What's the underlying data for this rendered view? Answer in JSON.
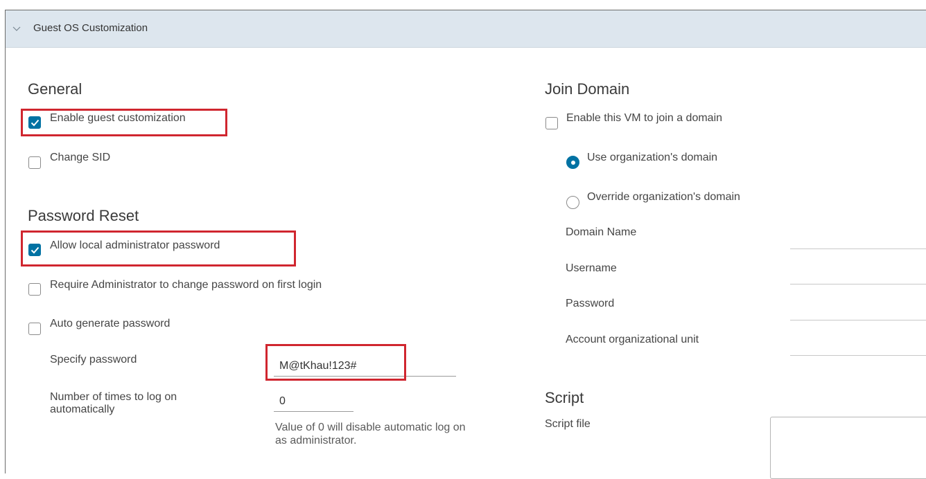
{
  "section": {
    "title": "Guest OS Customization",
    "icon": "chevron-down-icon"
  },
  "general": {
    "heading": "General",
    "enable_guest_customization": {
      "label": "Enable guest customization",
      "checked": true
    },
    "change_sid": {
      "label": "Change SID",
      "checked": false
    }
  },
  "password_reset": {
    "heading": "Password Reset",
    "allow_local_admin_password": {
      "label": "Allow local administrator password",
      "checked": true
    },
    "require_admin_change": {
      "label": "Require Administrator to change password on first login",
      "checked": false
    },
    "auto_generate": {
      "label": "Auto generate password",
      "checked": false
    },
    "specify_password": {
      "label": "Specify password",
      "value": "M@tKhau!123#"
    },
    "auto_logon": {
      "label_line1": "Number of times to log on",
      "label_line2": "automatically",
      "value": "0",
      "helper_line1": "Value of 0 will disable automatic log on",
      "helper_line2": "as administrator."
    }
  },
  "join_domain": {
    "heading": "Join Domain",
    "enable_join": {
      "label": "Enable this VM to join a domain",
      "checked": false
    },
    "use_org_domain": {
      "label": "Use organization's domain",
      "selected": true
    },
    "override_org_domain": {
      "label": "Override organization's domain",
      "selected": false
    },
    "domain_name": {
      "label": "Domain Name",
      "value": ""
    },
    "username": {
      "label": "Username",
      "value": ""
    },
    "password": {
      "label": "Password",
      "value": ""
    },
    "account_ou": {
      "label": "Account organizational unit",
      "value": ""
    }
  },
  "script": {
    "heading": "Script",
    "script_file_label": "Script file",
    "script_file_value": ""
  },
  "colors": {
    "accent": "#0072a3",
    "highlight": "#d0262f",
    "header_bg": "#dde6ee"
  }
}
